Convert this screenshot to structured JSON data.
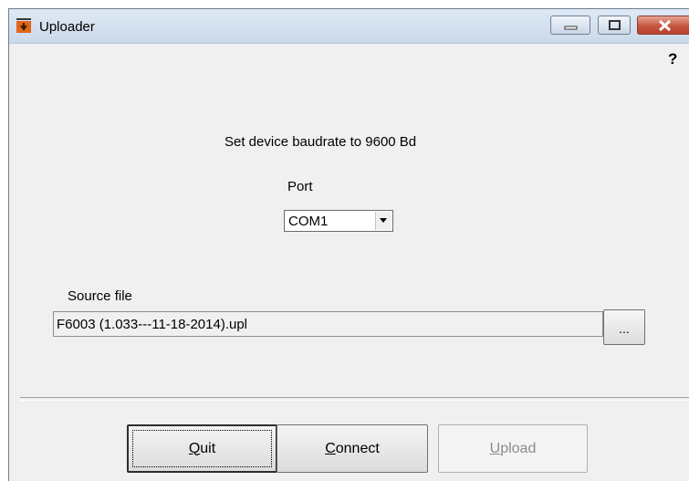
{
  "window": {
    "title": "Uploader"
  },
  "help_label": "?",
  "instruction": "Set device baudrate to 9600 Bd",
  "port": {
    "label": "Port",
    "value": "COM1"
  },
  "source_file": {
    "label": "Source file",
    "value": "F6003 (1.033---11-18-2014).upl",
    "browse_label": "..."
  },
  "buttons": {
    "quit": {
      "mnemonic": "Q",
      "rest": "uit"
    },
    "connect": {
      "mnemonic": "C",
      "rest": "onnect"
    },
    "upload": {
      "mnemonic": "U",
      "rest": "pload"
    }
  },
  "colors": {
    "close_button": "#c65540",
    "window_bg": "#f0f0f0",
    "disabled_text": "#8b8b8b"
  }
}
